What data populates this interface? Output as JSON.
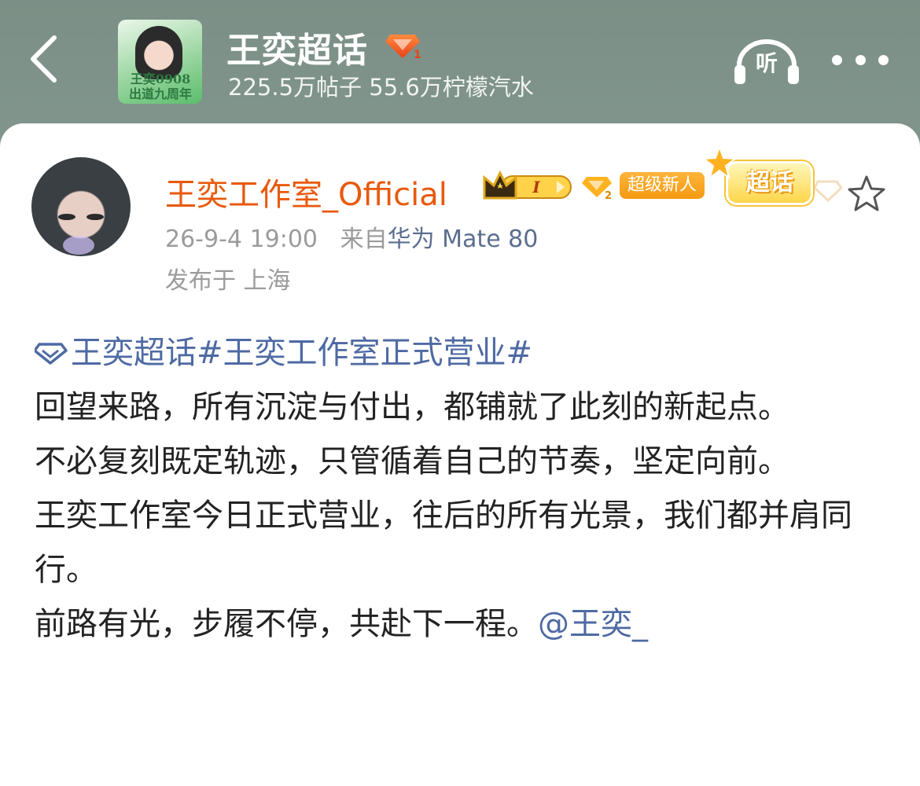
{
  "header": {
    "back_icon": "chevron-left-icon",
    "cover": {
      "text_line1": "王奕0908",
      "text_line2": "出道九周年"
    },
    "title": "王奕超话",
    "badge_level": "1",
    "stats": "225.5万帖子 55.6万柠檬汽水",
    "listen_label": "听",
    "more_icon": "more-horizontal-icon"
  },
  "post": {
    "username": "王奕工作室_Official",
    "crown_level": "I",
    "diamond_level": "2",
    "newbie_badge": "超级新人",
    "chaohua_sticker": "超话",
    "time": "26-9-4 19:00",
    "source_prefix": "来自",
    "device": "华为 Mate 80",
    "location": "发布于 上海",
    "topic_tags": "王奕超话#王奕工作室正式营业#",
    "paragraphs": [
      "回望来路，所有沉淀与付出，都铺就了此刻的新起点。",
      "不必复刻既定轨迹，只管循着自己的节奏，坚定向前。",
      "王奕工作室今日正式营业，往后的所有光景，我们都并肩同行。"
    ],
    "last_paragraph": "前路有光，步履不停，共赴下一程。",
    "mention": "@王奕_"
  },
  "colors": {
    "username": "#e8590c",
    "link": "#4e6aa3",
    "meta_gray": "#9b9b9b",
    "badge_orange": "#f59a12"
  }
}
